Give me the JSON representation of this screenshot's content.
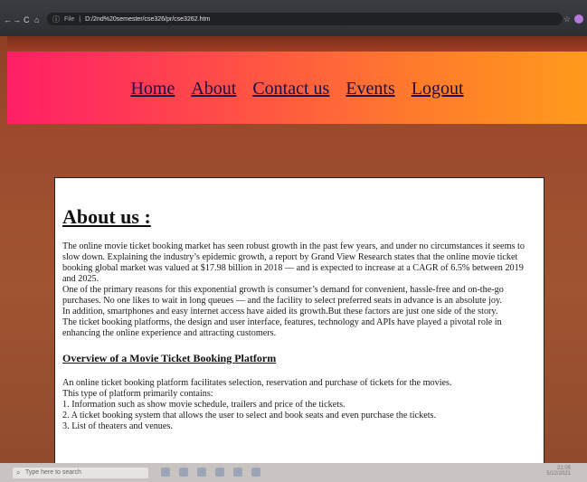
{
  "browser": {
    "info_icon": "info-icon",
    "scheme": "File",
    "url": "D:/2nd%20semester/cse326/pr/cse3262.htm",
    "back": "←",
    "forward": "→",
    "reload": "C",
    "home": "⌂",
    "star": "☆"
  },
  "nav": {
    "items": [
      "Home",
      "About",
      "Contact us",
      "Events",
      "Logout"
    ]
  },
  "about": {
    "title": "About us :",
    "paragraph": "The online movie ticket booking market has seen robust growth in the past few years, and under no circumstances it seems to slow down. Explaining the industry’s epidemic growth, a report by Grand View Research states that the online movie ticket booking global market was valued at $17.98 billion in 2018 — and is expected to increase at a CAGR of 6.5% between 2019 and 2025.",
    "line2": "One of the primary reasons for this exponential growth is consumer’s demand for convenient, hassle-free and on-the-go purchases. No one likes to wait in long queues — and the facility to select preferred seats in advance is an absolute joy.",
    "line3": "In addition, smartphones and easy internet access have aided its growth.But these factors are just one side of the story.",
    "line4": "The ticket booking platforms, the design and user interface, features, technology and APIs have played a pivotal role in enhancing the online experience and attracting customers."
  },
  "overview": {
    "title": "Overview of a Movie Ticket Booking Platform",
    "intro": "An online ticket booking platform facilitates selection, reservation and purchase of tickets for the movies.",
    "contains": "This type of platform primarily contains:",
    "items": [
      "1. Information such as show movie schedule, trailers and price of the tickets.",
      "2. A ticket booking system that allows the user to select and book seats and even purchase the tickets.",
      "3. List of theaters and venues."
    ]
  },
  "taskbar": {
    "search_placeholder": "Type here to search",
    "time": "21:05",
    "date": "5/12/2021"
  }
}
